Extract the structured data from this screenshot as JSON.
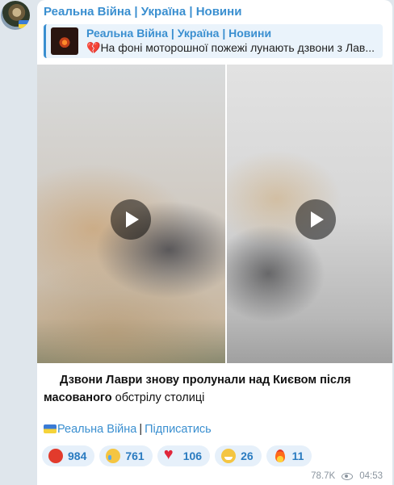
{
  "post": {
    "channel_name": "Реальна Війна | Україна | Новини",
    "reply": {
      "title": "Реальна Війна | Україна | Новини",
      "text_prefix": "💔",
      "text": "На фоні моторошної пожежі лунають дзвони з Лав..."
    },
    "body": {
      "line1": "Дзвони Лаври знову пролунали над Києвом після",
      "line2_bold": "масованого",
      "line2_rest": " обстрілу столиці"
    },
    "footer": {
      "channel_link": "Реальна Війна",
      "separator": "|",
      "subscribe_link": "Підписатись"
    },
    "reactions": [
      {
        "icon": "angry-face-icon",
        "count": "984"
      },
      {
        "icon": "crying-face-icon",
        "count": "761"
      },
      {
        "icon": "red-heart-icon",
        "count": "106"
      },
      {
        "icon": "grinning-face-icon",
        "count": "26"
      },
      {
        "icon": "fire-icon",
        "count": "11"
      }
    ],
    "views": "78.7K",
    "time": "04:53"
  },
  "colors": {
    "accent": "#3a8fd0",
    "background": "#dfe6ec",
    "bubble": "#ffffff",
    "reaction_bg": "#e6f0fa"
  }
}
